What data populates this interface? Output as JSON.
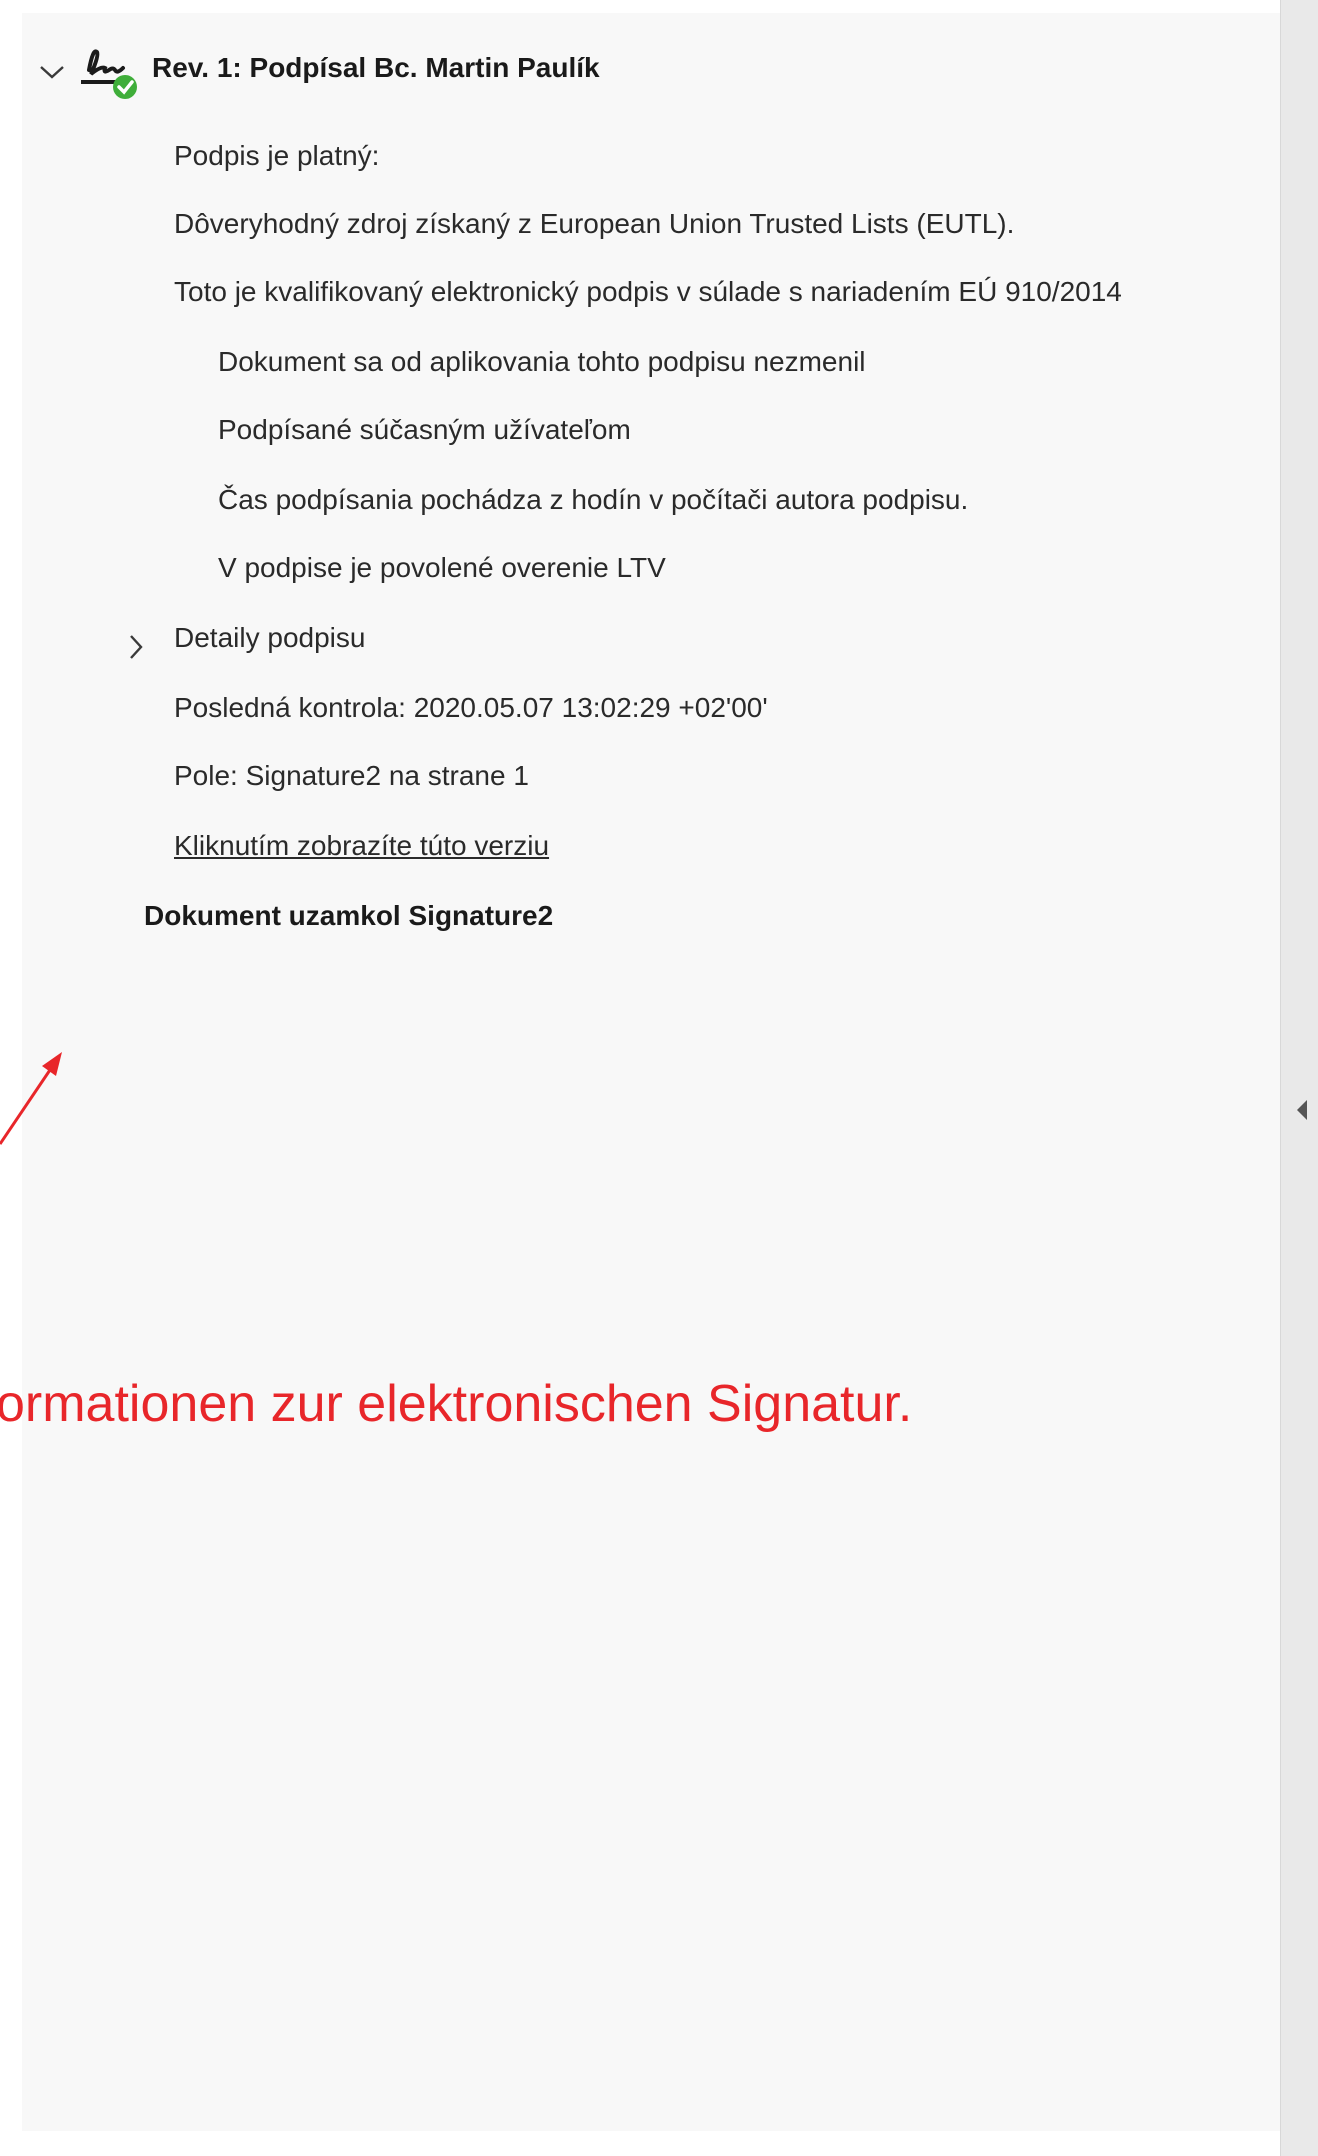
{
  "signature_panel": {
    "revision_title": "Rev. 1: Podpísal Bc. Martin Paulík",
    "items": [
      "Podpis je platný:",
      "Dôveryhodný zdroj získaný z European Union Trusted Lists (EUTL).",
      "Toto je kvalifikovaný elektronický podpis v súlade s nariadením EÚ 910/2014"
    ],
    "sub_items": [
      "Dokument sa od aplikovania tohto podpisu nezmenil",
      "Podpísané súčasným užívateľom",
      "Čas podpísania pochádza z hodín v počítači autora podpisu.",
      "V podpise je povolené overenie LTV"
    ],
    "details_label": "Detaily podpisu",
    "last_check": "Posledná kontrola: 2020.05.07 13:02:29 +02'00'",
    "field": "Pole: Signature2 na strane 1",
    "view_version_link": "Kliknutím zobrazíte túto verziu",
    "locked_by": "Dokument uzamkol Signature2"
  },
  "annotation": {
    "caption": "ormationen zur elektronischen Signatur.",
    "color": "#e8262a"
  },
  "icons": {
    "expand": "chevron-down-icon",
    "signature": "signature-valid-icon",
    "details": "chevron-right-icon",
    "panel_collapse": "triangle-left-icon"
  }
}
